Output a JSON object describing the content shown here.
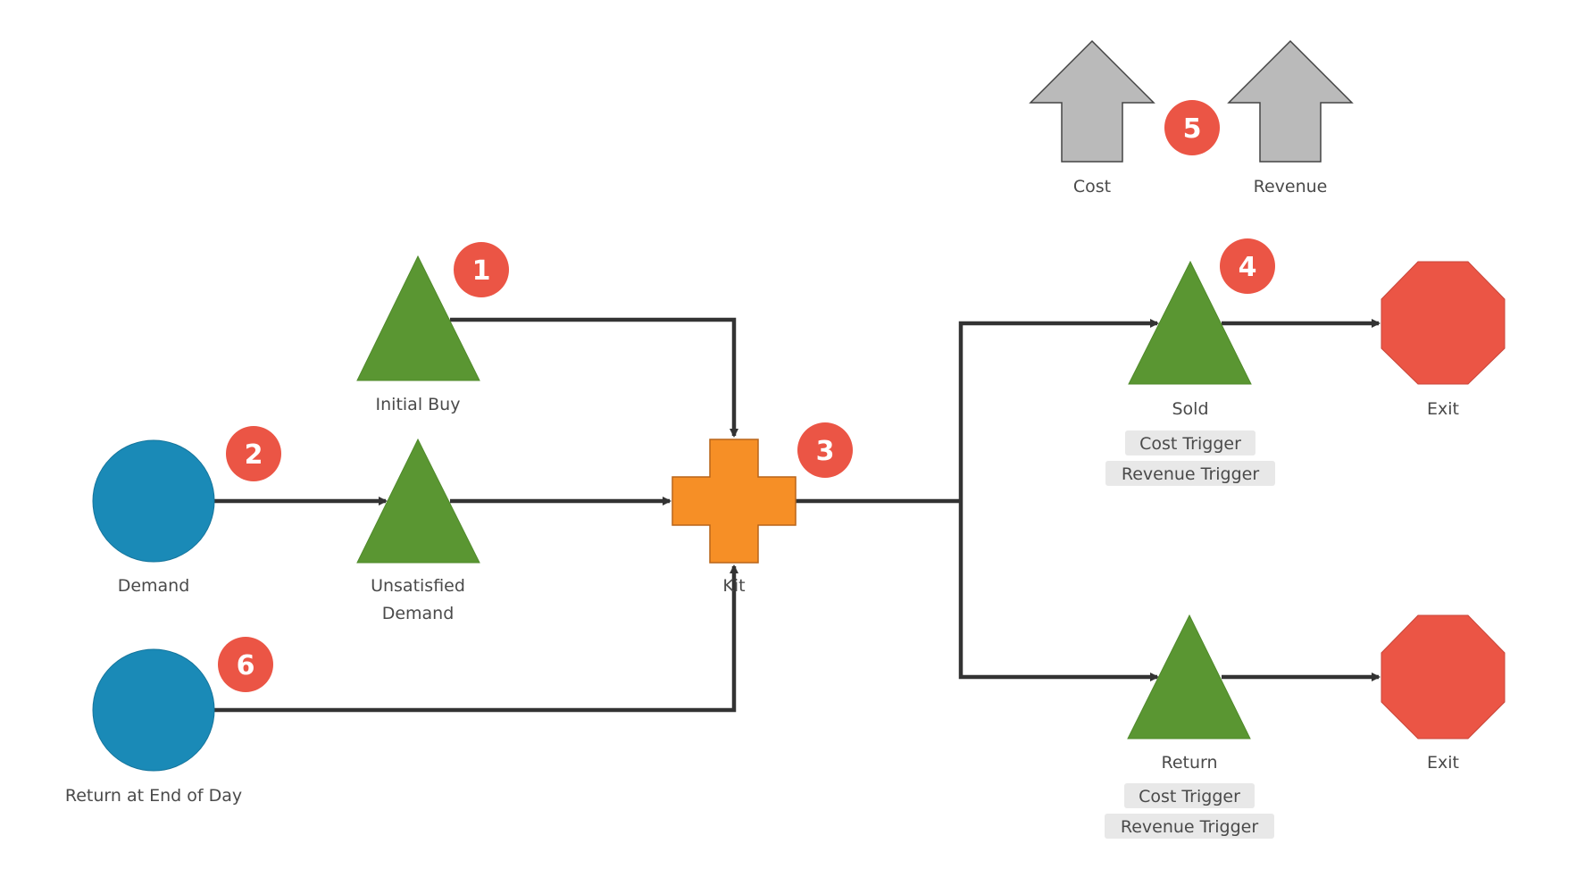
{
  "colors": {
    "source": "#1a8ab7",
    "queue": "#5a9632",
    "kit": "#f68f26",
    "exit": "#eb5545",
    "arrow": "#bababa",
    "badge": "#eb5545",
    "tag": "#e8e8e8",
    "line": "#333333"
  },
  "nodes": {
    "demand": {
      "label": "Demand",
      "icon": "circle"
    },
    "return_eod": {
      "label": "Return at End of Day",
      "icon": "circle"
    },
    "initial_buy": {
      "label": "Initial Buy",
      "icon": "triangle"
    },
    "unsatisfied": {
      "label_line1": "Unsatisfied",
      "label_line2": "Demand",
      "icon": "triangle"
    },
    "kit": {
      "label": "Kit",
      "icon": "cross"
    },
    "sold": {
      "label": "Sold",
      "tags": [
        "Cost Trigger",
        "Revenue Trigger"
      ],
      "icon": "triangle"
    },
    "return": {
      "label": "Return",
      "tags": [
        "Cost Trigger",
        "Revenue Trigger"
      ],
      "icon": "triangle"
    },
    "exit1": {
      "label": "Exit",
      "icon": "octagon"
    },
    "exit2": {
      "label": "Exit",
      "icon": "octagon"
    },
    "cost": {
      "label": "Cost",
      "icon": "up-arrow"
    },
    "revenue": {
      "label": "Revenue",
      "icon": "up-arrow"
    }
  },
  "badges": [
    "1",
    "2",
    "3",
    "4",
    "5",
    "6"
  ]
}
